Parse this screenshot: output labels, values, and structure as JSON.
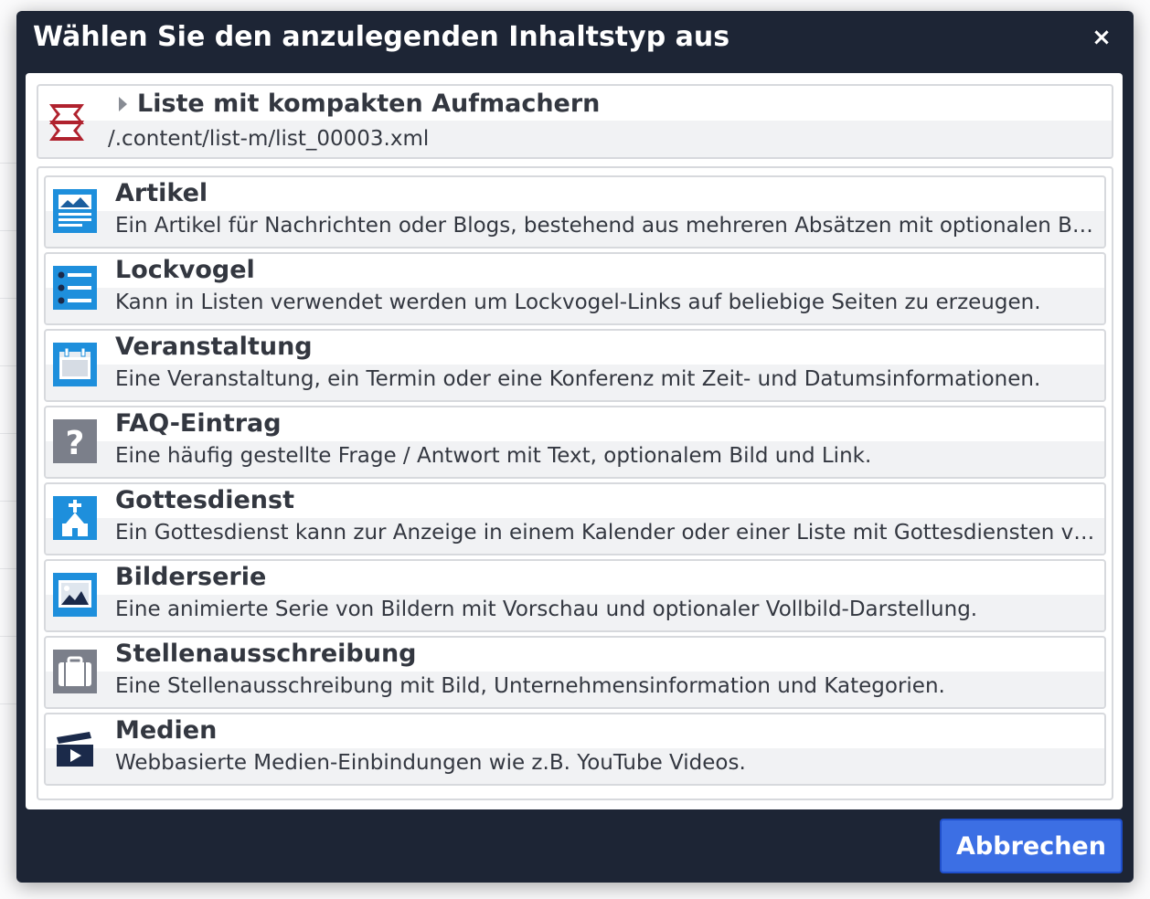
{
  "dialog": {
    "title": "Wählen Sie den anzulegenden Inhaltstyp aus",
    "close_label": "×",
    "cancel_label": "Abbrechen"
  },
  "parent": {
    "title": "Liste mit kompakten Aufmachern",
    "path": "/.content/list-m/list_00003.xml",
    "icon": "list-banner-icon"
  },
  "types": [
    {
      "title": "Artikel",
      "description": "Ein Artikel für Nachrichten oder Blogs, bestehend aus mehreren Absätzen mit optionalen Bildern.",
      "icon": "article-icon"
    },
    {
      "title": "Lockvogel",
      "description": "Kann in Listen verwendet werden um Lockvogel-Links auf beliebige Seiten zu erzeugen.",
      "icon": "teaser-list-icon"
    },
    {
      "title": "Veranstaltung",
      "description": "Eine Veranstaltung, ein Termin oder eine Konferenz mit Zeit- und Datumsinformationen.",
      "icon": "calendar-icon"
    },
    {
      "title": "FAQ-Eintrag",
      "description": "Eine häufig gestellte Frage / Antwort mit Text, optionalem Bild und Link.",
      "icon": "question-icon"
    },
    {
      "title": "Gottesdienst",
      "description": "Ein Gottesdienst kann zur Anzeige in einem Kalender oder einer Liste mit Gottesdiensten verwendet werden.",
      "icon": "church-icon"
    },
    {
      "title": "Bilderserie",
      "description": "Eine animierte Serie von Bildern mit Vorschau und optionaler Vollbild-Darstellung.",
      "icon": "image-icon"
    },
    {
      "title": "Stellenausschreibung",
      "description": "Eine Stellenausschreibung mit Bild, Unternehmensinformation und Kategorien.",
      "icon": "briefcase-icon"
    },
    {
      "title": "Medien",
      "description": "Webbasierte Medien-Einbindungen wie z.B. YouTube Videos.",
      "icon": "media-icon"
    }
  ],
  "colors": {
    "dialog_bg": "#1d2535",
    "accent_blue": "#3c6fe4",
    "icon_blue": "#1e8fdc",
    "icon_gray": "#7b7f8a",
    "icon_navy": "#1b2a4a",
    "icon_red": "#b0222e"
  }
}
